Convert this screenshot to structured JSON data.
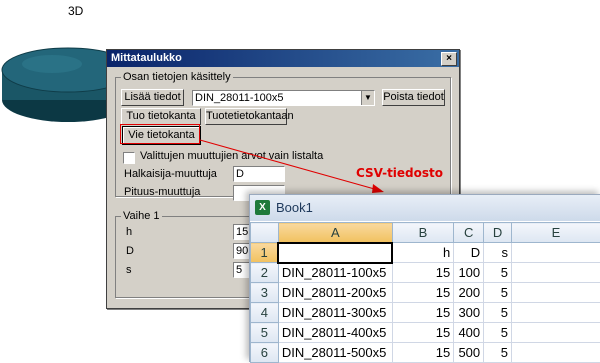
{
  "illustration": {
    "label": "3D"
  },
  "dialog": {
    "title": "Mittataulukko",
    "close": "×",
    "group_parts": {
      "label": "Osan tietojen käsittely",
      "add_button": "Lisää tiedot",
      "part_combo": "DIN_28011-100x5",
      "remove_button": "Poista tiedot",
      "import_button": "Tuo tietokanta",
      "product_db_button": "Tuotetietokantaan",
      "export_button": "Vie tietokanta",
      "checkbox_label": "Valittujen muuttujien arvot vain listalta",
      "diameter_label": "Halkaisija-muuttuja",
      "diameter_value": "D",
      "length_label": "Pituus-muuttuja",
      "length_value": ""
    },
    "group_step": {
      "label": "Vaihe 1",
      "rows": [
        {
          "name": "h",
          "value": "15"
        },
        {
          "name": "D",
          "value": "90"
        },
        {
          "name": "s",
          "value": "5"
        }
      ]
    }
  },
  "annotation": {
    "csv_label": "CSV-tiedosto",
    "color": "#e00000"
  },
  "excel": {
    "title": "Book1",
    "icon": "X",
    "columns": [
      "A",
      "B",
      "C",
      "D",
      "E"
    ],
    "rows": [
      {
        "n": "1",
        "cells": [
          "",
          "h",
          "D",
          "s",
          ""
        ]
      },
      {
        "n": "2",
        "cells": [
          "DIN_28011-100x5",
          "15",
          "100",
          "5",
          ""
        ]
      },
      {
        "n": "3",
        "cells": [
          "DIN_28011-200x5",
          "15",
          "200",
          "5",
          ""
        ]
      },
      {
        "n": "4",
        "cells": [
          "DIN_28011-300x5",
          "15",
          "300",
          "5",
          ""
        ]
      },
      {
        "n": "5",
        "cells": [
          "DIN_28011-400x5",
          "15",
          "400",
          "5",
          ""
        ]
      },
      {
        "n": "6",
        "cells": [
          "DIN_28011-500x5",
          "15",
          "500",
          "5",
          ""
        ]
      }
    ]
  }
}
